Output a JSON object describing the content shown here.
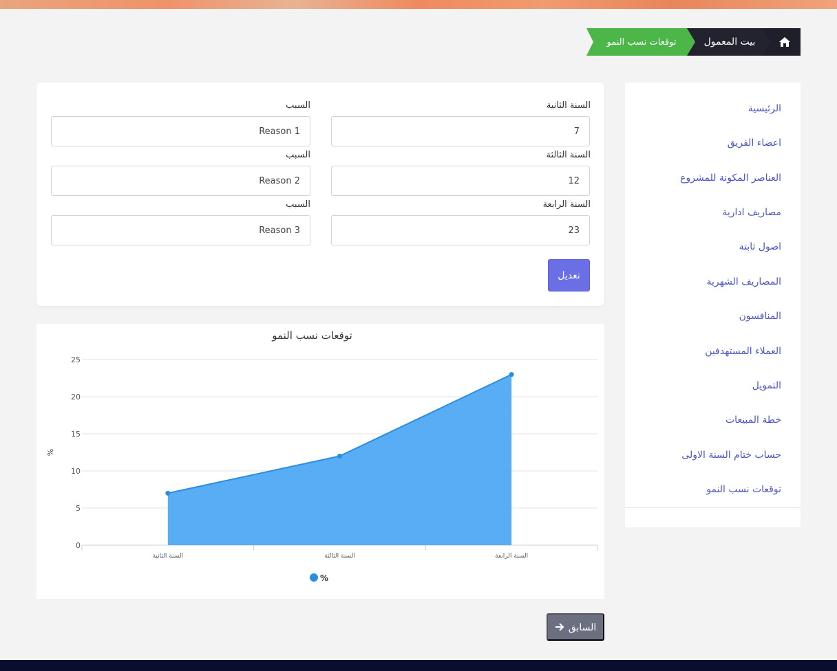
{
  "breadcrumb": {
    "home_icon": "home-icon",
    "parent": "بيت المعمول",
    "current": "توقعات نسب النمو"
  },
  "form": {
    "rows": [
      {
        "year_label": "السنة الثانية",
        "year_value": "7",
        "reason_label": "السبب",
        "reason_value": "Reason 1"
      },
      {
        "year_label": "السنة الثالثة",
        "year_value": "12",
        "reason_label": "السبب",
        "reason_value": "Reason 2"
      },
      {
        "year_label": "السنة الرابعة",
        "year_value": "23",
        "reason_label": "السبب",
        "reason_value": "Reason 3"
      }
    ],
    "submit_label": "تعديل"
  },
  "chart_data": {
    "type": "area",
    "title": "توقعات نسب النمو",
    "ylabel": "%",
    "categories": [
      "السنة الثانية",
      "السنة الثالثة",
      "السنة الرابعة"
    ],
    "series": [
      {
        "name": "%",
        "values": [
          7,
          12,
          23
        ]
      }
    ],
    "ylim": [
      0,
      25
    ],
    "yticks": [
      0,
      5,
      10,
      15,
      20,
      25
    ],
    "grid": true,
    "legend_position": "bottom",
    "colors": {
      "fill": "#4aa6f3",
      "line": "#2a8de0",
      "point": "#2a8de0"
    }
  },
  "sidebar": {
    "items": [
      {
        "label": "الرئيسية"
      },
      {
        "label": "اعضاء الفريق"
      },
      {
        "label": "العناصر المكونة للمشروع"
      },
      {
        "label": "مصاريف ادارية"
      },
      {
        "label": "اصول ثابتة"
      },
      {
        "label": "المصاريف الشهرية"
      },
      {
        "label": "المنافسون"
      },
      {
        "label": "العملاء المستهدفين"
      },
      {
        "label": "التمويل"
      },
      {
        "label": "خطة المبيعات"
      },
      {
        "label": "حساب ختام السنة الاولى"
      },
      {
        "label": "توقعات نسب النمو"
      }
    ]
  },
  "navigation": {
    "prev_label": "السابق",
    "prev_icon": "arrow-right-icon"
  },
  "colors": {
    "accent": "#6b6fe6",
    "breadcrumb_active": "#4cb648",
    "link": "#4a55c4"
  }
}
